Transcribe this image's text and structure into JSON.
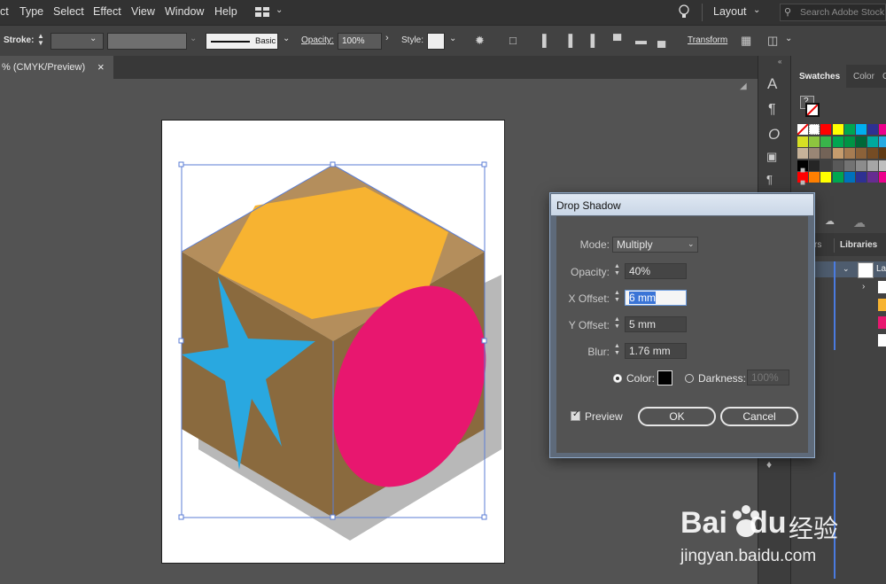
{
  "menu": {
    "items": [
      "ct",
      "Type",
      "Select",
      "Effect",
      "View",
      "Window",
      "Help"
    ],
    "layout_label": "Layout",
    "search_placeholder": "Search Adobe Stock"
  },
  "control_bar": {
    "stroke_label": "Stroke:",
    "brush_label": "Basic",
    "opacity_label": "Opacity:",
    "opacity_value": "100%",
    "style_label": "Style:",
    "transform_label": "Transform"
  },
  "document_tab": {
    "title": "% (CMYK/Preview)",
    "close_glyph": "×"
  },
  "panels": {
    "swatches_tab": "Swatches",
    "color_tab": "Color",
    "cut_tab": "C",
    "layers_tab_partial": "rs",
    "libraries_tab": "Libraries",
    "layer_name_partial": "La",
    "help_glyph": "?"
  },
  "swatch_colors": [
    [
      "#ffffff",
      "#000000",
      "#ff0000",
      "#ffff00",
      "#00a651",
      "#00aeef",
      "#2e3192",
      "#ec008c",
      "#00a79d"
    ],
    [
      "#d7df23",
      "#8dc63f",
      "#39b54a",
      "#00a651",
      "#009444",
      "#006838",
      "#00a99d",
      "#27aae1",
      "#1c75bc"
    ],
    [
      "#c7b299",
      "#998675",
      "#736357",
      "#c69c6d",
      "#a67c52",
      "#8c6239",
      "#754c24",
      "#603913",
      "#42210b"
    ],
    [
      "#000000",
      "#252525",
      "#404040",
      "#595959",
      "#737373",
      "#8c8c8c",
      "#a6a6a6",
      "#bfbfbf",
      "#d9d9d9"
    ],
    [
      "#ff0000",
      "#ff7f00",
      "#ffff00",
      "#00a651",
      "#0072bc",
      "#2e3192",
      "#662d91",
      "#ec008c",
      "#ed1c24"
    ]
  ],
  "dialog": {
    "title": "Drop Shadow",
    "mode_label": "Mode:",
    "mode_value": "Multiply",
    "opacity_label": "Opacity:",
    "opacity_value": "40%",
    "x_offset_label": "X Offset:",
    "x_offset_value": "6 mm",
    "y_offset_label": "Y Offset:",
    "y_offset_value": "5 mm",
    "blur_label": "Blur:",
    "blur_value": "1.76 mm",
    "color_label": "Color:",
    "darkness_label": "Darkness:",
    "darkness_value": "100%",
    "preview_label": "Preview",
    "ok_label": "OK",
    "cancel_label": "Cancel"
  },
  "watermark": {
    "brand": "Bai",
    "brand2": "du",
    "cn": "经验",
    "url": "jingyan.baidu.com"
  },
  "colors": {
    "cube_brown": "#8a6a3e",
    "cube_top": "#b48e5c",
    "hexagon": "#f7b331",
    "ellipse": "#e8176f",
    "star": "#29a8e0",
    "selection": "#5b7ed6"
  }
}
